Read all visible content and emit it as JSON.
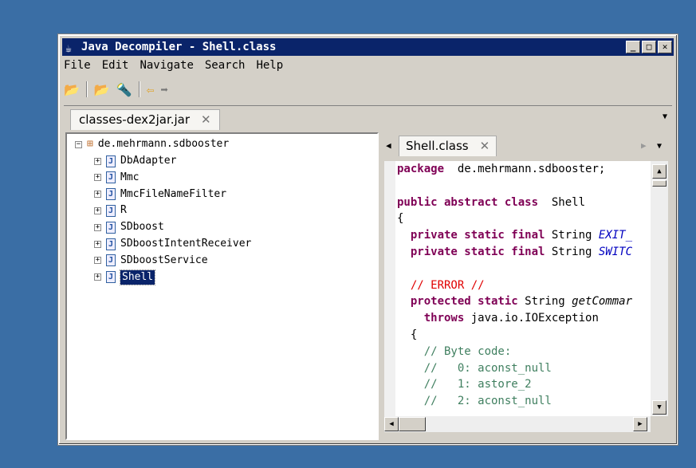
{
  "window": {
    "title": "Java Decompiler - Shell.class"
  },
  "menu": [
    "File",
    "Edit",
    "Navigate",
    "Search",
    "Help"
  ],
  "toolbar": {
    "icons": [
      "open-folder-icon",
      "open-type-icon",
      "search-icon",
      "back-arrow-icon",
      "forward-arrow-icon"
    ]
  },
  "file_tab": {
    "label": "classes-dex2jar.jar"
  },
  "tree": {
    "package": "de.mehrmann.sdbooster",
    "classes": [
      "DbAdapter",
      "Mmc",
      "MmcFileNameFilter",
      "R",
      "SDboost",
      "SDboostIntentReceiver",
      "SDboostService",
      "Shell"
    ],
    "selected": "Shell"
  },
  "editor_tab": {
    "label": "Shell.class"
  },
  "code": [
    {
      "parts": [
        [
          "kw",
          "package"
        ],
        [
          "",
          "  de.mehrmann.sdbooster;"
        ]
      ]
    },
    {
      "parts": []
    },
    {
      "parts": [
        [
          "kw",
          "public abstract class"
        ],
        [
          "",
          "  Shell"
        ]
      ]
    },
    {
      "parts": [
        [
          "",
          "{"
        ]
      ]
    },
    {
      "parts": [
        [
          "",
          "  "
        ],
        [
          "kw",
          "private static final"
        ],
        [
          "",
          " String "
        ],
        [
          "it",
          "EXIT_"
        ]
      ]
    },
    {
      "parts": [
        [
          "",
          "  "
        ],
        [
          "kw",
          "private static final"
        ],
        [
          "",
          " String "
        ],
        [
          "it",
          "SWITC"
        ]
      ]
    },
    {
      "parts": []
    },
    {
      "parts": [
        [
          "",
          "  "
        ],
        [
          "er",
          "// ERROR //"
        ]
      ]
    },
    {
      "parts": [
        [
          "",
          "  "
        ],
        [
          "kw",
          "protected static"
        ],
        [
          "",
          " String "
        ],
        [
          "mi",
          "getCommar"
        ]
      ]
    },
    {
      "parts": [
        [
          "",
          "    "
        ],
        [
          "kw",
          "throws"
        ],
        [
          "",
          " java.io.IOException"
        ]
      ]
    },
    {
      "parts": [
        [
          "",
          "  {"
        ]
      ]
    },
    {
      "parts": [
        [
          "",
          "    "
        ],
        [
          "cm",
          "// Byte code:"
        ]
      ]
    },
    {
      "parts": [
        [
          "",
          "    "
        ],
        [
          "cm",
          "//   0: aconst_null"
        ]
      ]
    },
    {
      "parts": [
        [
          "",
          "    "
        ],
        [
          "cm",
          "//   1: astore_2"
        ]
      ]
    },
    {
      "parts": [
        [
          "",
          "    "
        ],
        [
          "cm",
          "//   2: aconst_null"
        ]
      ]
    }
  ]
}
